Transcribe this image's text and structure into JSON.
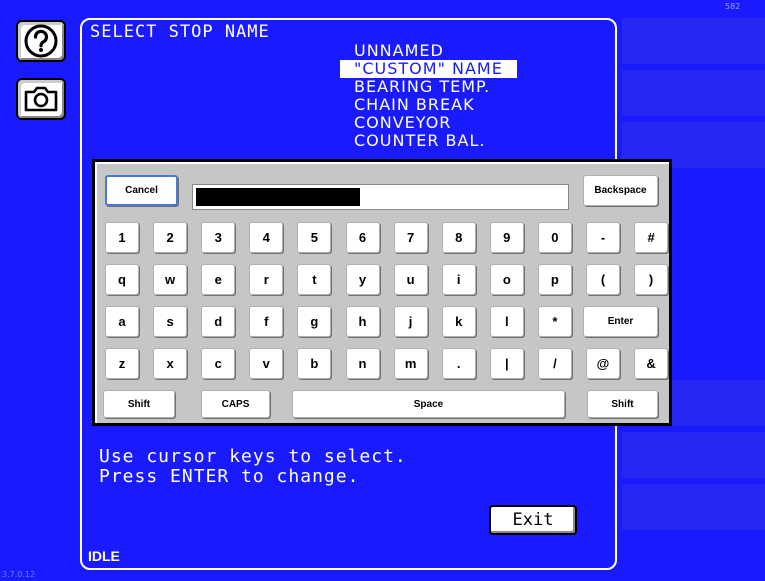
{
  "corner_tag": "582",
  "version": "3.7.0.12",
  "screen": {
    "title": "SELECT STOP NAME",
    "stop_names": [
      "UNNAMED",
      "\"CUSTOM\" NAME",
      "BEARING TEMP.",
      "CHAIN BREAK",
      "CONVEYOR",
      "COUNTER BAL."
    ],
    "selected_index": 1,
    "hint_line1": "Use cursor keys to select.",
    "hint_line2": "Press ENTER to change.",
    "exit_label": "Exit",
    "status": "IDLE"
  },
  "keyboard": {
    "cancel_label": "Cancel",
    "backspace_label": "Backspace",
    "entry_value": "",
    "row1": [
      "1",
      "2",
      "3",
      "4",
      "5",
      "6",
      "7",
      "8",
      "9",
      "0",
      "-",
      "#"
    ],
    "row2": [
      "q",
      "w",
      "e",
      "r",
      "t",
      "y",
      "u",
      "i",
      "o",
      "p",
      "(",
      ")"
    ],
    "row3": [
      "a",
      "s",
      "d",
      "f",
      "g",
      "h",
      "j",
      "k",
      "l",
      "*"
    ],
    "enter_label": "Enter",
    "row4": [
      "z",
      "x",
      "c",
      "v",
      "b",
      "n",
      "m",
      ".",
      "|",
      "/",
      "@",
      "&"
    ],
    "shift_left_label": "Shift",
    "caps_label": "CAPS",
    "space_label": "Space",
    "shift_right_label": "Shift"
  },
  "icons": {
    "help": "question-mark-icon",
    "camera": "camera-icon"
  },
  "colors": {
    "background": "#1a1aff",
    "panel_border": "#ffffff",
    "keyboard": "#c6c6c6"
  }
}
